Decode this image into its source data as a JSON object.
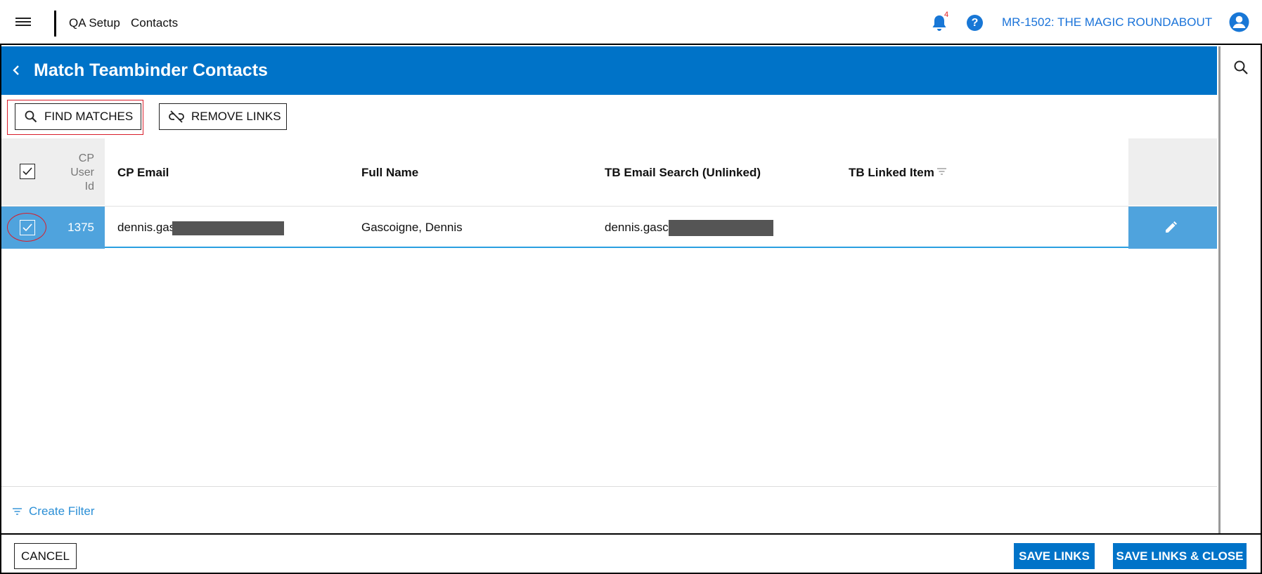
{
  "topbar": {
    "breadcrumb": [
      "QA Setup",
      "Contacts"
    ],
    "notification_count": "4",
    "help_label": "?",
    "project_label": "MR-1502: THE MAGIC ROUNDABOUT"
  },
  "header": {
    "title": "Match Teambinder Contacts"
  },
  "toolbar": {
    "find_matches_label": "FIND MATCHES",
    "remove_links_label": "REMOVE LINKS"
  },
  "table": {
    "columns": {
      "user_id": [
        "CP",
        "User",
        "Id"
      ],
      "cp_email": "CP Email",
      "full_name": "Full Name",
      "tb_email_search": "TB Email Search (Unlinked)",
      "tb_linked_item": "TB Linked Item"
    },
    "rows": [
      {
        "selected": true,
        "user_id": "1375",
        "cp_email": "dennis.gas",
        "full_name": "Gascoigne, Dennis",
        "tb_email_search": "dennis.gasc",
        "tb_linked_item": ""
      }
    ]
  },
  "footer": {
    "create_filter_label": "Create Filter",
    "cancel_label": "CANCEL",
    "save_links_label": "SAVE LINKS",
    "save_links_close_label": "SAVE LINKS & CLOSE"
  },
  "icons": {
    "menu": "hamburger-icon",
    "bell": "bell-icon",
    "help": "help-icon",
    "user": "user-icon",
    "back": "chevron-left-icon",
    "search": "search-icon",
    "unlink": "unlink-icon",
    "edit": "pencil-icon",
    "filter": "filter-icon"
  },
  "colors": {
    "primary": "#0073c8",
    "selected_row": "#4fa3dd",
    "highlight": "#d81e2b",
    "link": "#1a73d9"
  }
}
